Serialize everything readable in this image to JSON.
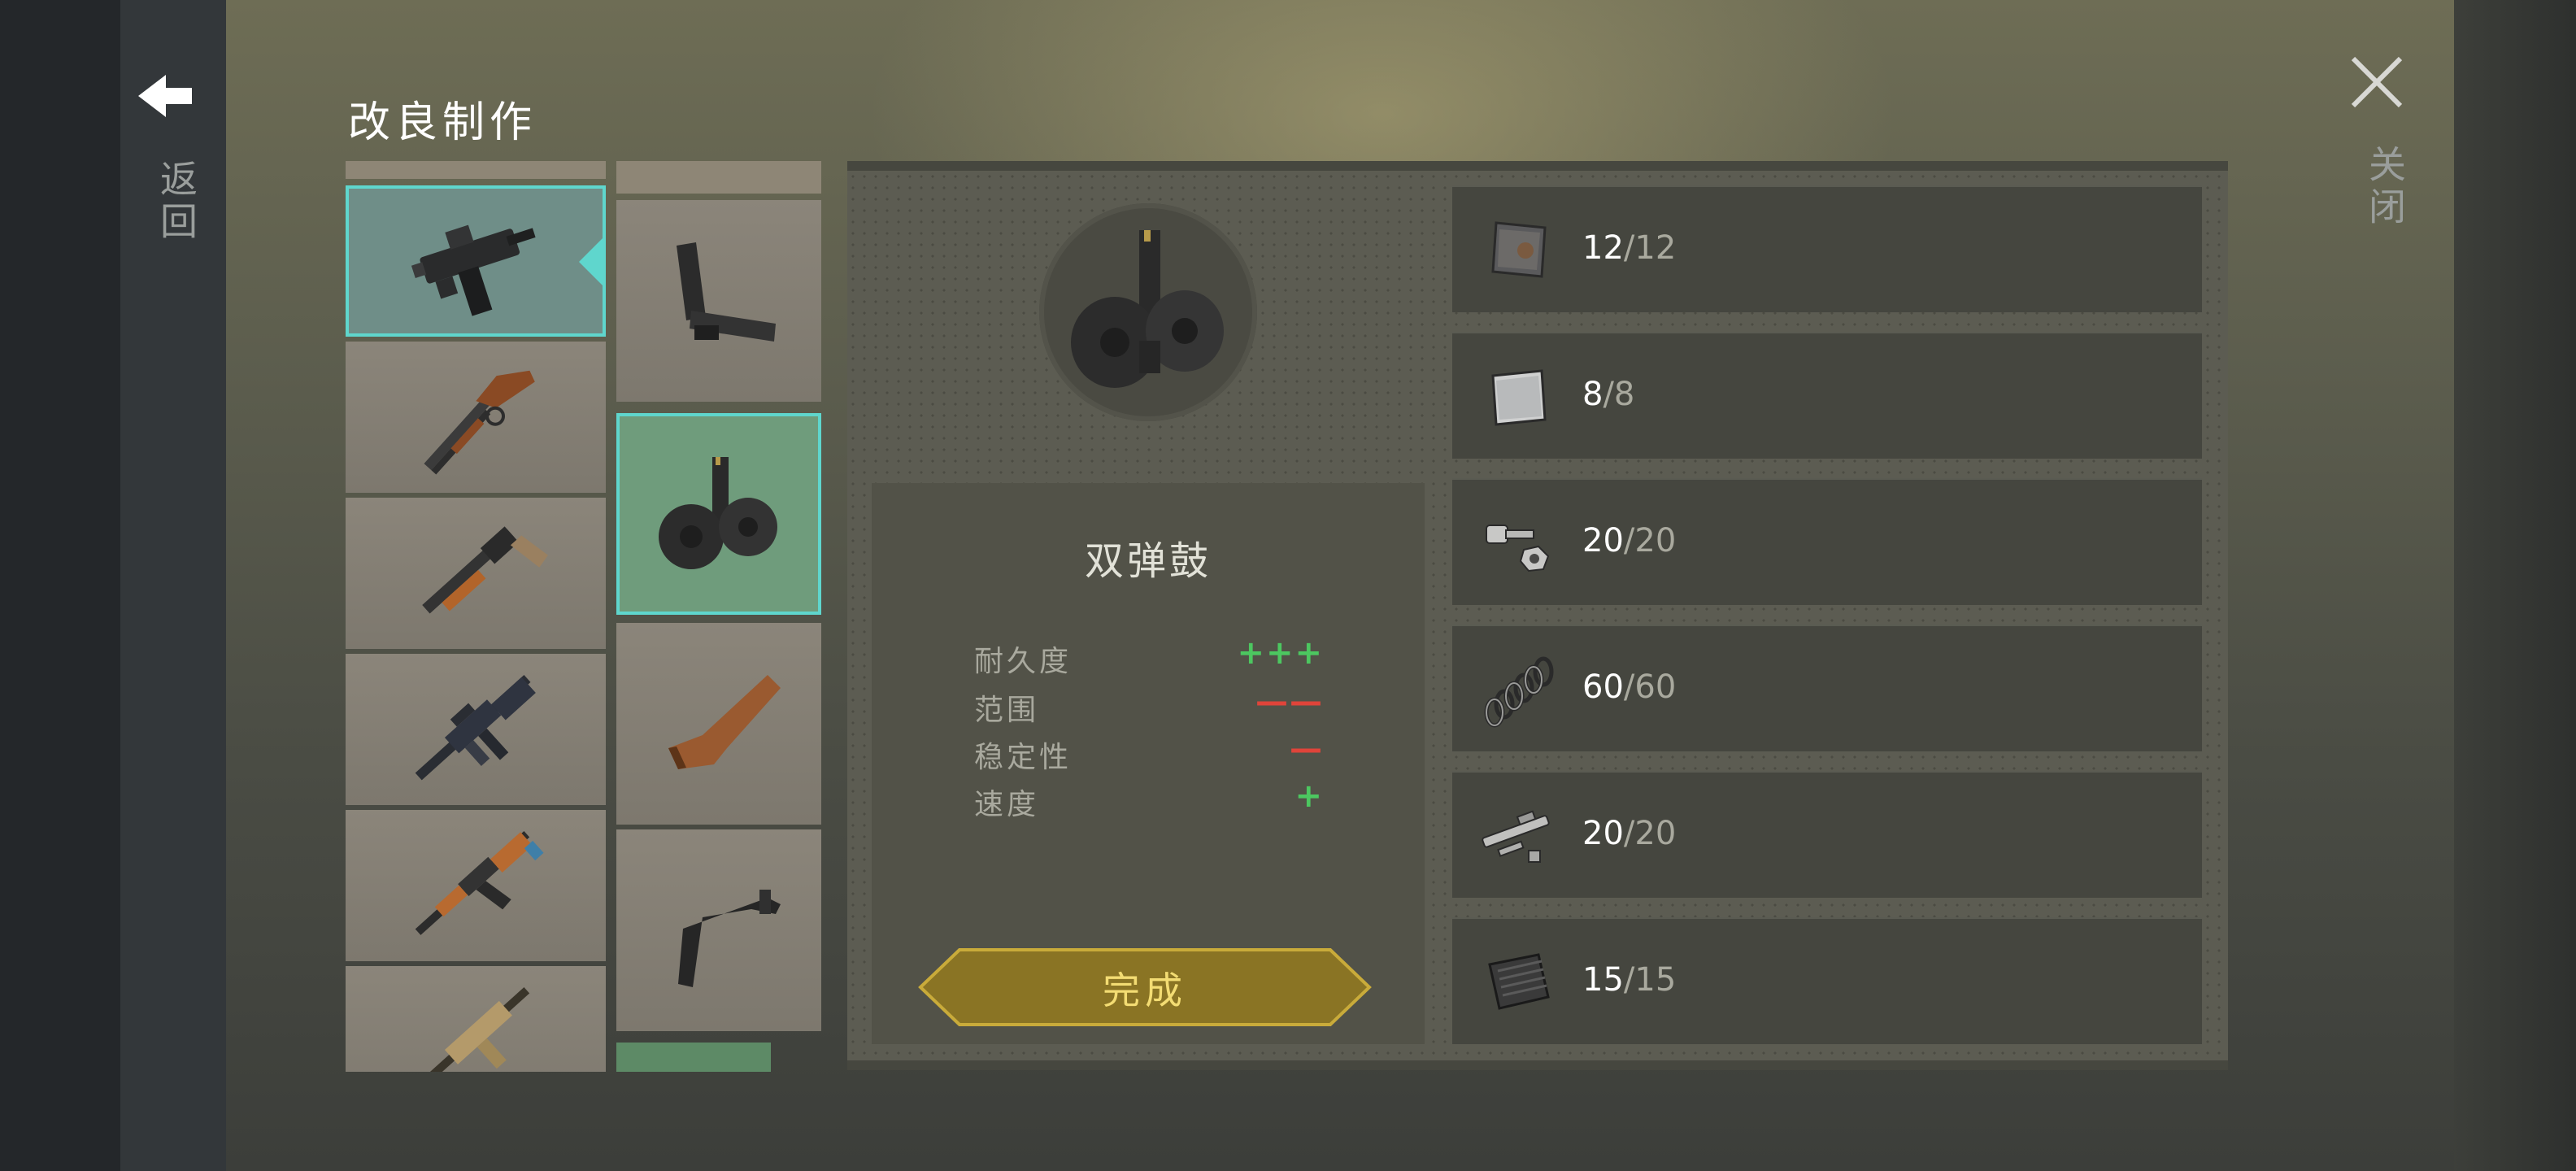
{
  "header": {
    "title": "改良制作",
    "back_label": "返回",
    "close_label": "关闭"
  },
  "icons": {
    "back": "arrow-left-icon",
    "close": "close-x-icon"
  },
  "weapons": [
    {
      "name": "uzi-smg",
      "selected": true
    },
    {
      "name": "lever-action-rifle",
      "selected": false
    },
    {
      "name": "pump-shotgun",
      "selected": false
    },
    {
      "name": "m16-rifle",
      "selected": false
    },
    {
      "name": "ak-rifle",
      "selected": false
    },
    {
      "name": "tan-rifle",
      "selected": false
    }
  ],
  "parts": [
    {
      "name": "extended-magazine",
      "selected": false
    },
    {
      "name": "double-drum-magazine",
      "selected": true
    },
    {
      "name": "wooden-stock",
      "selected": false
    },
    {
      "name": "folding-stock",
      "selected": false
    }
  ],
  "item": {
    "name": "双弹鼓",
    "stats": [
      {
        "label": "耐久度",
        "value": "+++",
        "type": "plus"
      },
      {
        "label": "范围",
        "value": "——",
        "type": "minus"
      },
      {
        "label": "稳定性",
        "value": "—",
        "type": "minus"
      },
      {
        "label": "速度",
        "value": "+",
        "type": "plus"
      }
    ]
  },
  "complete_button": {
    "label": "完成"
  },
  "materials": [
    {
      "icon": "metal-plate-icon",
      "have": "12",
      "need": "/12"
    },
    {
      "icon": "steel-sheet-icon",
      "have": "8",
      "need": "/8"
    },
    {
      "icon": "bolt-nut-icon",
      "have": "20",
      "need": "/20"
    },
    {
      "icon": "spring-icon",
      "have": "60",
      "need": "/60"
    },
    {
      "icon": "gun-parts-icon",
      "have": "20",
      "need": "/20"
    },
    {
      "icon": "sheet-metal-icon",
      "have": "15",
      "need": "/15"
    }
  ],
  "colors": {
    "selected_border": "#5fd6cd",
    "plus": "#4cc760",
    "minus": "#e0443a",
    "button_gold": "#8a7424",
    "button_text": "#f3dc73"
  }
}
